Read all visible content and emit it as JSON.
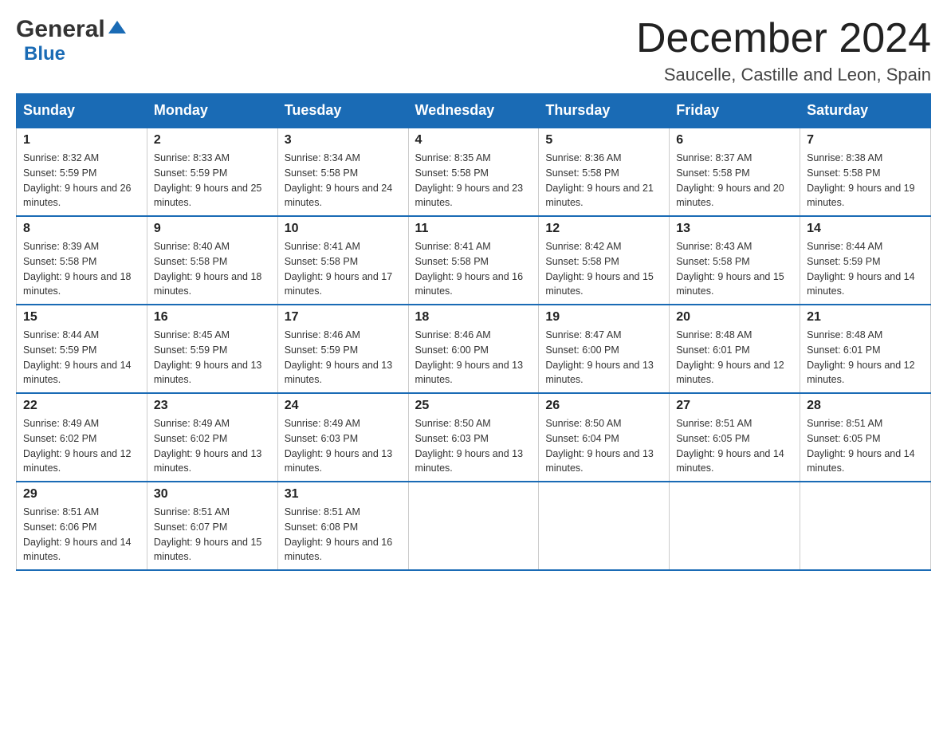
{
  "header": {
    "logo_general": "General",
    "logo_blue": "Blue",
    "month_title": "December 2024",
    "location": "Saucelle, Castille and Leon, Spain"
  },
  "weekdays": [
    "Sunday",
    "Monday",
    "Tuesday",
    "Wednesday",
    "Thursday",
    "Friday",
    "Saturday"
  ],
  "weeks": [
    [
      {
        "day": "1",
        "sunrise": "Sunrise: 8:32 AM",
        "sunset": "Sunset: 5:59 PM",
        "daylight": "Daylight: 9 hours and 26 minutes."
      },
      {
        "day": "2",
        "sunrise": "Sunrise: 8:33 AM",
        "sunset": "Sunset: 5:59 PM",
        "daylight": "Daylight: 9 hours and 25 minutes."
      },
      {
        "day": "3",
        "sunrise": "Sunrise: 8:34 AM",
        "sunset": "Sunset: 5:58 PM",
        "daylight": "Daylight: 9 hours and 24 minutes."
      },
      {
        "day": "4",
        "sunrise": "Sunrise: 8:35 AM",
        "sunset": "Sunset: 5:58 PM",
        "daylight": "Daylight: 9 hours and 23 minutes."
      },
      {
        "day": "5",
        "sunrise": "Sunrise: 8:36 AM",
        "sunset": "Sunset: 5:58 PM",
        "daylight": "Daylight: 9 hours and 21 minutes."
      },
      {
        "day": "6",
        "sunrise": "Sunrise: 8:37 AM",
        "sunset": "Sunset: 5:58 PM",
        "daylight": "Daylight: 9 hours and 20 minutes."
      },
      {
        "day": "7",
        "sunrise": "Sunrise: 8:38 AM",
        "sunset": "Sunset: 5:58 PM",
        "daylight": "Daylight: 9 hours and 19 minutes."
      }
    ],
    [
      {
        "day": "8",
        "sunrise": "Sunrise: 8:39 AM",
        "sunset": "Sunset: 5:58 PM",
        "daylight": "Daylight: 9 hours and 18 minutes."
      },
      {
        "day": "9",
        "sunrise": "Sunrise: 8:40 AM",
        "sunset": "Sunset: 5:58 PM",
        "daylight": "Daylight: 9 hours and 18 minutes."
      },
      {
        "day": "10",
        "sunrise": "Sunrise: 8:41 AM",
        "sunset": "Sunset: 5:58 PM",
        "daylight": "Daylight: 9 hours and 17 minutes."
      },
      {
        "day": "11",
        "sunrise": "Sunrise: 8:41 AM",
        "sunset": "Sunset: 5:58 PM",
        "daylight": "Daylight: 9 hours and 16 minutes."
      },
      {
        "day": "12",
        "sunrise": "Sunrise: 8:42 AM",
        "sunset": "Sunset: 5:58 PM",
        "daylight": "Daylight: 9 hours and 15 minutes."
      },
      {
        "day": "13",
        "sunrise": "Sunrise: 8:43 AM",
        "sunset": "Sunset: 5:58 PM",
        "daylight": "Daylight: 9 hours and 15 minutes."
      },
      {
        "day": "14",
        "sunrise": "Sunrise: 8:44 AM",
        "sunset": "Sunset: 5:59 PM",
        "daylight": "Daylight: 9 hours and 14 minutes."
      }
    ],
    [
      {
        "day": "15",
        "sunrise": "Sunrise: 8:44 AM",
        "sunset": "Sunset: 5:59 PM",
        "daylight": "Daylight: 9 hours and 14 minutes."
      },
      {
        "day": "16",
        "sunrise": "Sunrise: 8:45 AM",
        "sunset": "Sunset: 5:59 PM",
        "daylight": "Daylight: 9 hours and 13 minutes."
      },
      {
        "day": "17",
        "sunrise": "Sunrise: 8:46 AM",
        "sunset": "Sunset: 5:59 PM",
        "daylight": "Daylight: 9 hours and 13 minutes."
      },
      {
        "day": "18",
        "sunrise": "Sunrise: 8:46 AM",
        "sunset": "Sunset: 6:00 PM",
        "daylight": "Daylight: 9 hours and 13 minutes."
      },
      {
        "day": "19",
        "sunrise": "Sunrise: 8:47 AM",
        "sunset": "Sunset: 6:00 PM",
        "daylight": "Daylight: 9 hours and 13 minutes."
      },
      {
        "day": "20",
        "sunrise": "Sunrise: 8:48 AM",
        "sunset": "Sunset: 6:01 PM",
        "daylight": "Daylight: 9 hours and 12 minutes."
      },
      {
        "day": "21",
        "sunrise": "Sunrise: 8:48 AM",
        "sunset": "Sunset: 6:01 PM",
        "daylight": "Daylight: 9 hours and 12 minutes."
      }
    ],
    [
      {
        "day": "22",
        "sunrise": "Sunrise: 8:49 AM",
        "sunset": "Sunset: 6:02 PM",
        "daylight": "Daylight: 9 hours and 12 minutes."
      },
      {
        "day": "23",
        "sunrise": "Sunrise: 8:49 AM",
        "sunset": "Sunset: 6:02 PM",
        "daylight": "Daylight: 9 hours and 13 minutes."
      },
      {
        "day": "24",
        "sunrise": "Sunrise: 8:49 AM",
        "sunset": "Sunset: 6:03 PM",
        "daylight": "Daylight: 9 hours and 13 minutes."
      },
      {
        "day": "25",
        "sunrise": "Sunrise: 8:50 AM",
        "sunset": "Sunset: 6:03 PM",
        "daylight": "Daylight: 9 hours and 13 minutes."
      },
      {
        "day": "26",
        "sunrise": "Sunrise: 8:50 AM",
        "sunset": "Sunset: 6:04 PM",
        "daylight": "Daylight: 9 hours and 13 minutes."
      },
      {
        "day": "27",
        "sunrise": "Sunrise: 8:51 AM",
        "sunset": "Sunset: 6:05 PM",
        "daylight": "Daylight: 9 hours and 14 minutes."
      },
      {
        "day": "28",
        "sunrise": "Sunrise: 8:51 AM",
        "sunset": "Sunset: 6:05 PM",
        "daylight": "Daylight: 9 hours and 14 minutes."
      }
    ],
    [
      {
        "day": "29",
        "sunrise": "Sunrise: 8:51 AM",
        "sunset": "Sunset: 6:06 PM",
        "daylight": "Daylight: 9 hours and 14 minutes."
      },
      {
        "day": "30",
        "sunrise": "Sunrise: 8:51 AM",
        "sunset": "Sunset: 6:07 PM",
        "daylight": "Daylight: 9 hours and 15 minutes."
      },
      {
        "day": "31",
        "sunrise": "Sunrise: 8:51 AM",
        "sunset": "Sunset: 6:08 PM",
        "daylight": "Daylight: 9 hours and 16 minutes."
      },
      null,
      null,
      null,
      null
    ]
  ]
}
